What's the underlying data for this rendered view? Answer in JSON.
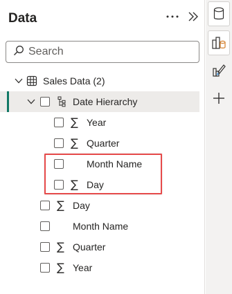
{
  "pane": {
    "title": "Data",
    "more_icon": "more-options-icon",
    "collapse_icon": "double-chevron-right-icon"
  },
  "search": {
    "placeholder": "Search",
    "icon": "search-icon"
  },
  "tree": {
    "table": {
      "label": "Sales Data (2)",
      "expanded": true,
      "icon": "table-icon"
    },
    "hierarchy": {
      "label": "Date Hierarchy",
      "expanded": true,
      "icon": "hierarchy-icon",
      "selected": true
    },
    "hierarchy_levels": [
      {
        "label": "Year",
        "sigma": true
      },
      {
        "label": "Quarter",
        "sigma": true
      },
      {
        "label": "Month Name",
        "sigma": false
      },
      {
        "label": "Day",
        "sigma": true
      }
    ],
    "fields": [
      {
        "label": "Day",
        "sigma": true
      },
      {
        "label": "Month Name",
        "sigma": false
      },
      {
        "label": "Quarter",
        "sigma": true
      },
      {
        "label": "Year",
        "sigma": true
      }
    ]
  },
  "rail": {
    "items": [
      "database-icon",
      "build-visual-icon",
      "format-visual-icon",
      "add-icon"
    ]
  },
  "colors": {
    "accent": "#117865",
    "highlight": "#e64a4a",
    "model_orange": "#d47f2a"
  }
}
